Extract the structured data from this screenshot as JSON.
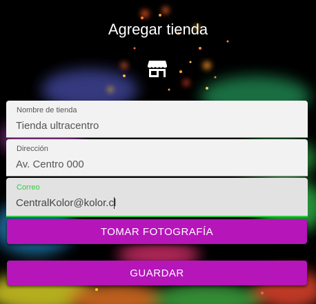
{
  "header": {
    "title": "Agregar tienda",
    "icon": "store-icon"
  },
  "form": {
    "store_name": {
      "label": "Nombre de tienda",
      "value": "Tienda ultracentro"
    },
    "address": {
      "label": "Dirección",
      "value": "Av. Centro 000"
    },
    "email": {
      "label": "Correo",
      "value": "CentralKolor@kolor.cl"
    }
  },
  "actions": {
    "take_photo_label": "TOMAR FOTOGRAFÍA",
    "save_label": "GUARDAR"
  },
  "colors": {
    "accent": "#b515b9",
    "focus": "#2ecc40",
    "background": "#000000"
  }
}
